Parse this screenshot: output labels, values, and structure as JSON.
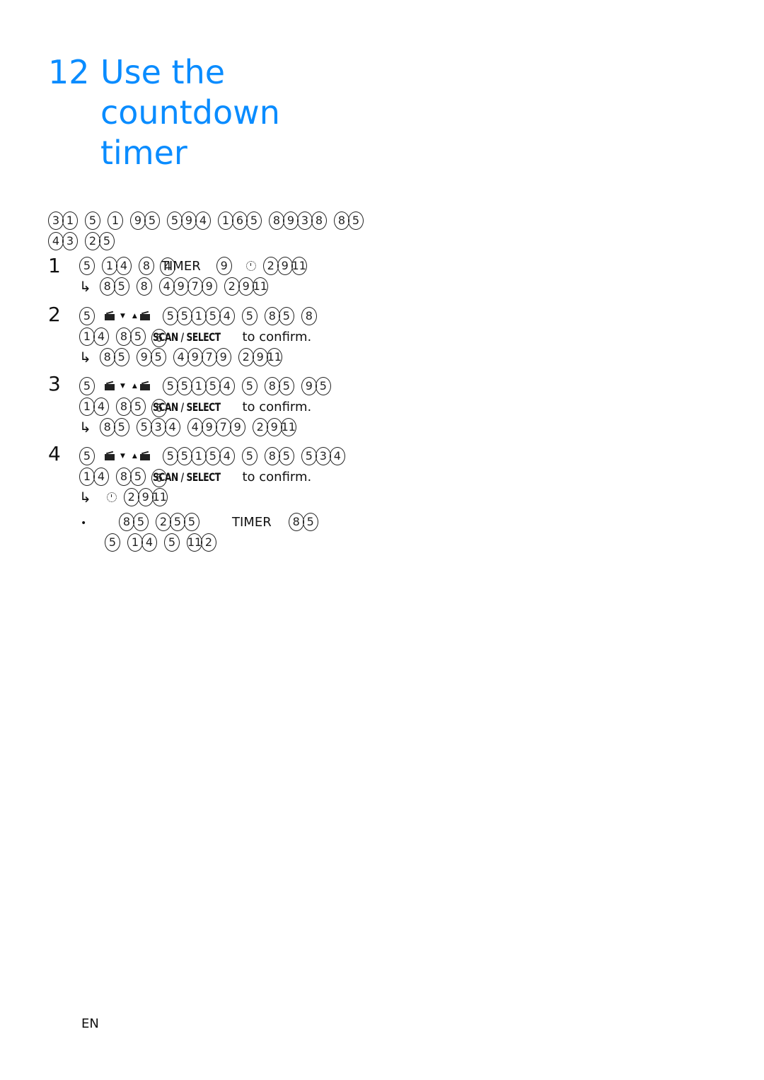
{
  "heading": {
    "number": "12",
    "lines": [
      "Use the",
      "countdown",
      "timer"
    ],
    "color": "#0A8CFF"
  },
  "intro": {
    "line1": [
      [
        "3",
        "1"
      ],
      [
        "5"
      ],
      [
        "1"
      ],
      [
        "9",
        "5"
      ],
      [
        "5",
        "9",
        "4"
      ],
      [
        "1",
        "6",
        "5"
      ],
      [
        "8",
        "9",
        "3",
        "8"
      ],
      [
        "8",
        "5"
      ]
    ],
    "line2": [
      [
        "4",
        "3"
      ],
      [
        "2",
        "5"
      ]
    ]
  },
  "steps": [
    {
      "number": "1",
      "line1": {
        "pre": [
          [
            "5"
          ],
          [
            "1",
            "4"
          ],
          [
            "8"
          ]
        ],
        "overlap_digit": "4",
        "keyword": "TIMER",
        "mid": [
          [
            "9"
          ]
        ],
        "icon": "clock-icon",
        "post": [
          [
            "2",
            "9",
            "11"
          ]
        ]
      },
      "result": [
        [
          "8",
          "5"
        ],
        [
          "8"
        ],
        [
          "4",
          "9",
          "7",
          "9"
        ],
        [
          "2",
          "9",
          "11"
        ]
      ]
    },
    {
      "number": "2",
      "line1": {
        "pre": [
          [
            "5"
          ]
        ],
        "icons": [
          "radio-down-icon",
          "radio-up-icon"
        ],
        "post": [
          [
            "5",
            "5",
            "1",
            "5",
            "4"
          ],
          [
            "5"
          ],
          [
            "8",
            "5"
          ],
          [
            "8"
          ]
        ]
      },
      "line2": {
        "pre": [
          [
            "1",
            "4"
          ],
          [
            "8",
            "5"
          ]
        ],
        "overlap_digit": "6",
        "keyword": "SCAN / SELECT",
        "tail": "to confirm."
      },
      "result": [
        [
          "8",
          "5"
        ],
        [
          "9",
          "5"
        ],
        [
          "4",
          "9",
          "7",
          "9"
        ],
        [
          "2",
          "9",
          "11"
        ]
      ]
    },
    {
      "number": "3",
      "line1": {
        "pre": [
          [
            "5"
          ]
        ],
        "icons": [
          "radio-down-icon",
          "radio-up-icon"
        ],
        "post": [
          [
            "5",
            "5",
            "1",
            "5",
            "4"
          ],
          [
            "5"
          ],
          [
            "8",
            "5"
          ],
          [
            "9",
            "5"
          ]
        ]
      },
      "line2": {
        "pre": [
          [
            "1",
            "4"
          ],
          [
            "8",
            "5"
          ]
        ],
        "overlap_digit": "6",
        "keyword": "SCAN / SELECT",
        "tail": "to confirm."
      },
      "result": [
        [
          "8",
          "5"
        ],
        [
          "5",
          "3",
          "4"
        ],
        [
          "4",
          "9",
          "7",
          "9"
        ],
        [
          "2",
          "9",
          "11"
        ]
      ]
    },
    {
      "number": "4",
      "line1": {
        "pre": [
          [
            "5"
          ]
        ],
        "icons": [
          "radio-down-icon",
          "radio-up-icon"
        ],
        "post": [
          [
            "5",
            "5",
            "1",
            "5",
            "4"
          ],
          [
            "5"
          ],
          [
            "8",
            "5"
          ],
          [
            "5",
            "3",
            "4"
          ]
        ]
      },
      "line2": {
        "pre": [
          [
            "1",
            "4"
          ],
          [
            "8",
            "5"
          ]
        ],
        "overlap_digit": "6",
        "keyword": "SCAN / SELECT",
        "tail": "to confirm."
      },
      "result_icon": "clock-icon",
      "result": [
        [
          "2",
          "9",
          "11"
        ]
      ]
    }
  ],
  "note": {
    "bullet": "•",
    "line1_pre": [
      [
        "8",
        "5"
      ],
      [
        "2",
        "5",
        "5"
      ]
    ],
    "keyword": "TIMER",
    "line1_post": [
      [
        "8",
        "5"
      ]
    ],
    "line2": [
      [
        "5"
      ],
      [
        "1",
        "4"
      ],
      [
        "5"
      ],
      [
        "11",
        "2"
      ]
    ]
  },
  "footer": {
    "language": "EN"
  },
  "symbols": {
    "arrow": "↳"
  }
}
